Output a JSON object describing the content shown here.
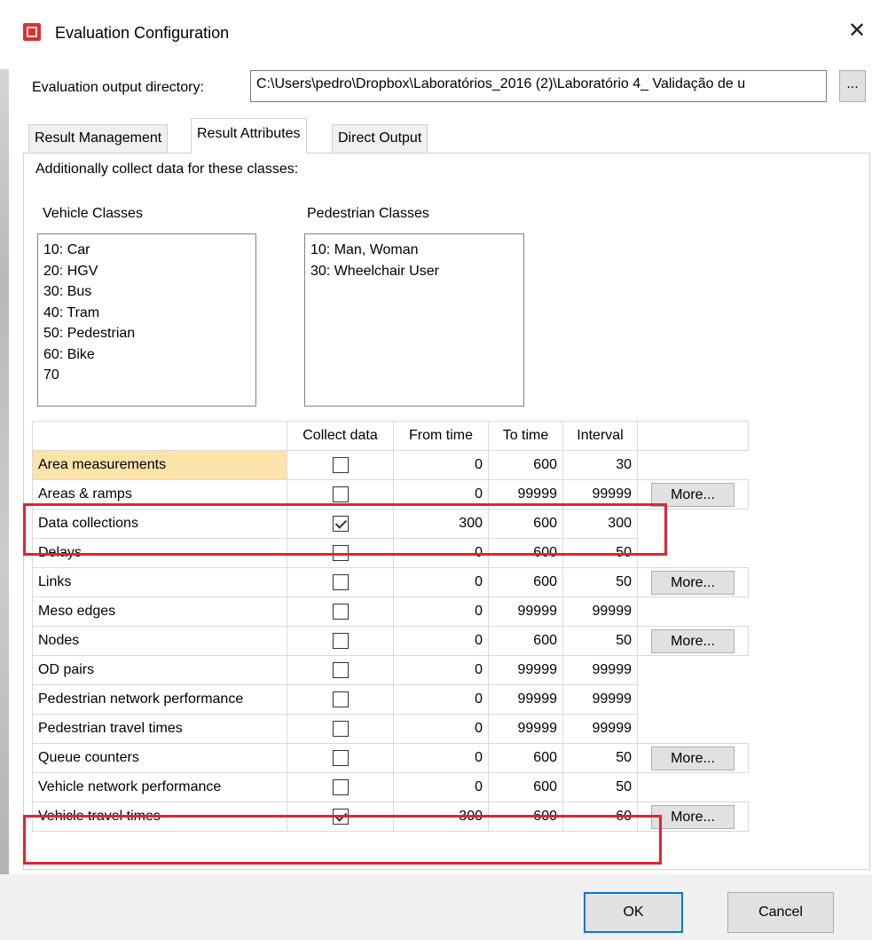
{
  "window": {
    "title": "Evaluation Configuration"
  },
  "output_dir": {
    "label": "Evaluation output directory:",
    "value": "C:\\Users\\pedro\\Dropbox\\Laboratórios_2016 (2)\\Laboratório 4_ Validação de u",
    "browse_label": "..."
  },
  "tabs": [
    {
      "label": "Result Management"
    },
    {
      "label": "Result Attributes"
    },
    {
      "label": "Direct Output"
    }
  ],
  "panel": {
    "additional_text": "Additionally collect data for these classes:",
    "vehicle_classes_label": "Vehicle Classes",
    "pedestrian_classes_label": "Pedestrian Classes",
    "vehicle_classes": [
      "10: Car",
      "20: HGV",
      "30: Bus",
      "40: Tram",
      "50: Pedestrian",
      "60: Bike",
      "70"
    ],
    "pedestrian_classes": [
      "10: Man, Woman",
      "30: Wheelchair User"
    ]
  },
  "grid": {
    "headers": {
      "name": "",
      "collect": "Collect data",
      "from": "From time",
      "to": "To time",
      "interval": "Interval",
      "action": ""
    },
    "rows": [
      {
        "name": "Area measurements",
        "collect": false,
        "from": "0",
        "to": "600",
        "interval": "30",
        "more": ""
      },
      {
        "name": "Areas & ramps",
        "collect": false,
        "from": "0",
        "to": "99999",
        "interval": "99999",
        "more": "More..."
      },
      {
        "name": "Data collections",
        "collect": true,
        "from": "300",
        "to": "600",
        "interval": "300",
        "more": ""
      },
      {
        "name": "Delays",
        "collect": false,
        "from": "0",
        "to": "600",
        "interval": "50",
        "more": ""
      },
      {
        "name": "Links",
        "collect": false,
        "from": "0",
        "to": "600",
        "interval": "50",
        "more": "More..."
      },
      {
        "name": "Meso edges",
        "collect": false,
        "from": "0",
        "to": "99999",
        "interval": "99999",
        "more": ""
      },
      {
        "name": "Nodes",
        "collect": false,
        "from": "0",
        "to": "600",
        "interval": "50",
        "more": "More..."
      },
      {
        "name": "OD pairs",
        "collect": false,
        "from": "0",
        "to": "99999",
        "interval": "99999",
        "more": ""
      },
      {
        "name": "Pedestrian network performance",
        "collect": false,
        "from": "0",
        "to": "99999",
        "interval": "99999",
        "more": ""
      },
      {
        "name": "Pedestrian travel times",
        "collect": false,
        "from": "0",
        "to": "99999",
        "interval": "99999",
        "more": ""
      },
      {
        "name": "Queue counters",
        "collect": false,
        "from": "0",
        "to": "600",
        "interval": "50",
        "more": "More..."
      },
      {
        "name": "Vehicle network performance",
        "collect": false,
        "from": "0",
        "to": "600",
        "interval": "50",
        "more": ""
      },
      {
        "name": "Vehicle travel times",
        "collect": true,
        "from": "300",
        "to": "600",
        "interval": "60",
        "more": "More..."
      }
    ]
  },
  "buttons": {
    "ok": "OK",
    "cancel": "Cancel"
  },
  "colors": {
    "highlight": "#e0242f",
    "selected_cell": "#fbe3a9",
    "ok_border": "#0078d7"
  }
}
